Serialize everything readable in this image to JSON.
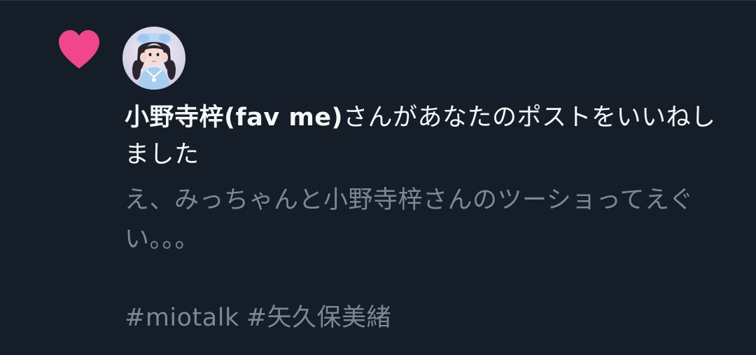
{
  "notification": {
    "type_icon": "heart-icon",
    "avatar_icon": "user-avatar",
    "user_name": "小野寺梓(fav me)",
    "action_text": "さんがあなたのポストをいいねしました",
    "post_text": "え、みっちゃんと小野寺梓さんのツーショってえぐい。。。",
    "hashtags": [
      "#miotalk",
      "#矢久保美緒"
    ]
  },
  "colors": {
    "background": "#151d28",
    "heart": "#f0468c",
    "primary_text": "#f4f6f8",
    "secondary_text": "#7c8895"
  }
}
